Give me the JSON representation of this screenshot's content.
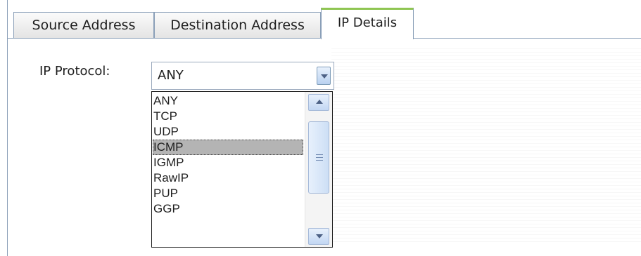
{
  "tabs": [
    {
      "label": "Source Address"
    },
    {
      "label": "Destination Address"
    },
    {
      "label": "IP Details",
      "active": true
    }
  ],
  "form": {
    "ip_protocol_label": "IP Protocol:",
    "ip_protocol_value": "ANY",
    "options": [
      "ANY",
      "TCP",
      "UDP",
      "ICMP",
      "IGMP",
      "RawIP",
      "PUP",
      "GGP"
    ],
    "highlighted_option": "ICMP"
  },
  "colors": {
    "active_tab_accent": "#8fc552",
    "selection_bg": "#b4b4b4",
    "border": "#8a9fb8"
  },
  "icons": {
    "combo_button": "chevron-down-icon",
    "scroll_up": "arrow-up-icon",
    "scroll_down": "arrow-down-icon",
    "thumb_grip": "grip-icon"
  }
}
